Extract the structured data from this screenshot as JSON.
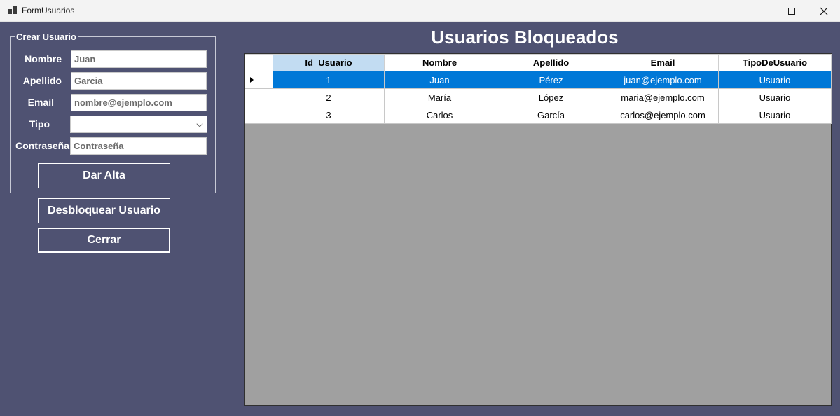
{
  "window": {
    "title": "FormUsuarios"
  },
  "form": {
    "group_title": "Crear Usuario",
    "fields": {
      "nombre": {
        "label": "Nombre",
        "value": "Juan"
      },
      "apellido": {
        "label": "Apellido",
        "value": "Garcia"
      },
      "email": {
        "label": "Email",
        "value": "nombre@ejemplo.com"
      },
      "tipo": {
        "label": "Tipo",
        "value": ""
      },
      "contrasena": {
        "label": "Contraseña",
        "value": "Contraseña"
      }
    },
    "dar_alta_label": "Dar Alta"
  },
  "actions": {
    "desbloquear_label": "Desbloquear Usuario",
    "cerrar_label": "Cerrar"
  },
  "main": {
    "heading": "Usuarios Bloqueados"
  },
  "grid": {
    "columns": [
      "Id_Usuario",
      "Nombre",
      "Apellido",
      "Email",
      "TipoDeUsuario"
    ],
    "rows": [
      [
        "1",
        "Juan",
        "Pérez",
        "juan@ejemplo.com",
        "Usuario"
      ],
      [
        "2",
        "María",
        "López",
        "maria@ejemplo.com",
        "Usuario"
      ],
      [
        "3",
        "Carlos",
        "García",
        "carlos@ejemplo.com",
        "Usuario"
      ]
    ],
    "selected_row": 0
  },
  "colors": {
    "background": "#4f5272",
    "selection": "#0078d7",
    "selected_header": "#c2dcf2",
    "grid_empty": "#a0a0a0"
  }
}
